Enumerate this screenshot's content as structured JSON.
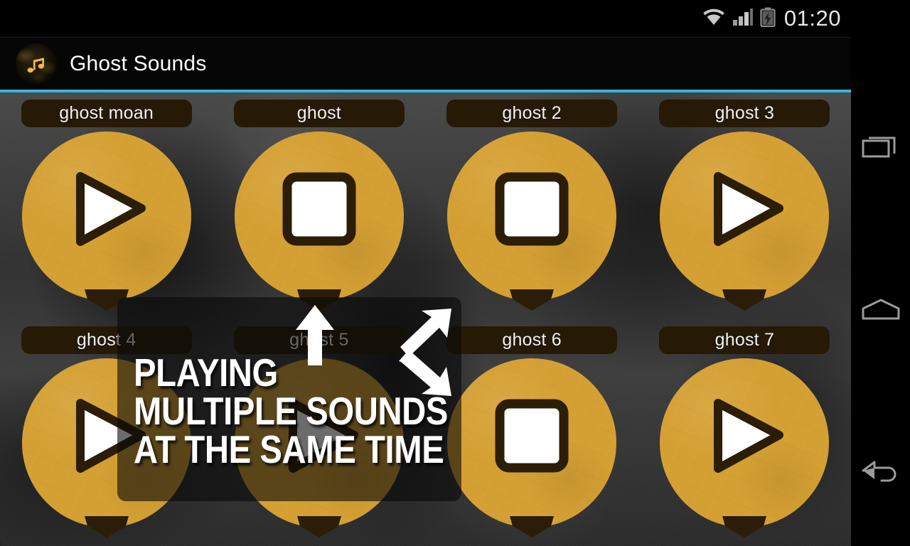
{
  "status_bar": {
    "time": "01:20",
    "icons": [
      "wifi-icon",
      "cellular-signal-icon",
      "battery-charging-icon"
    ]
  },
  "action_bar": {
    "app_title": "Ghost Sounds",
    "app_icon": "music-note-icon",
    "accent_color": "#33b5e5"
  },
  "theme": {
    "gold": "#d5a033",
    "dark_brown": "#261a06",
    "white": "#ffffff",
    "background": "#3b3b3b"
  },
  "sounds": [
    {
      "label": "ghost moan",
      "state": "play",
      "icon": "play-icon"
    },
    {
      "label": "ghost",
      "state": "stop",
      "icon": "stop-icon"
    },
    {
      "label": "ghost 2",
      "state": "stop",
      "icon": "stop-icon"
    },
    {
      "label": "ghost 3",
      "state": "play",
      "icon": "play-icon"
    },
    {
      "label": "ghost 4",
      "state": "play",
      "icon": "play-icon"
    },
    {
      "label": "ghost 5",
      "state": "play",
      "icon": "play-icon"
    },
    {
      "label": "ghost 6",
      "state": "stop",
      "icon": "stop-icon"
    },
    {
      "label": "ghost 7",
      "state": "play",
      "icon": "play-icon"
    }
  ],
  "tutorial_overlay": {
    "line1": "PLAYING",
    "line2": "MULTIPLE SOUNDS",
    "line3": "AT THE SAME TIME",
    "arrows": [
      "arrow-up-icon",
      "arrow-up-right-icon",
      "arrow-down-right-icon"
    ]
  },
  "nav_bar": {
    "recents": "recents-icon",
    "home": "home-icon",
    "back": "back-icon"
  }
}
